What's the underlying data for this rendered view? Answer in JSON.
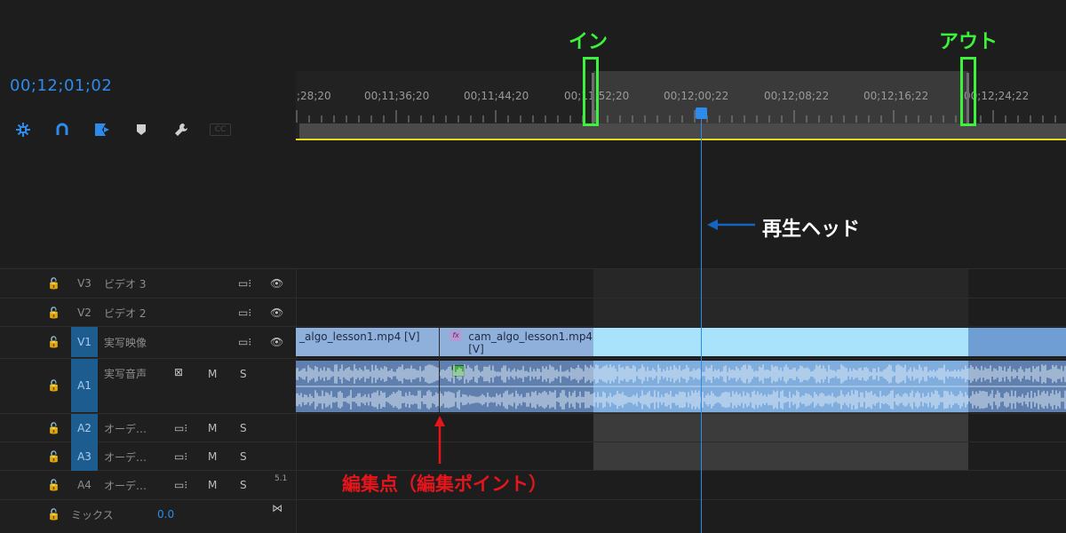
{
  "timecode": "00;12;01;02",
  "ruler": {
    "ticks": [
      ";28;20",
      "00;11;36;20",
      "00;11;44;20",
      "00;11;52;20",
      "00;12;00;22",
      "00;12;08;22",
      "00;12;16;22",
      "00;12;24;22"
    ]
  },
  "toolbar": {
    "icons": [
      "snap-icon",
      "magnet-link-icon",
      "add-marker-icon",
      "marker-icon",
      "wrench-icon",
      "captions-icon"
    ],
    "captions_label": "CC"
  },
  "tracks": {
    "v3": {
      "name": "V3",
      "label": "ビデオ 3"
    },
    "v2": {
      "name": "V2",
      "label": "ビデオ 2"
    },
    "v1": {
      "name": "V1",
      "label": "実写映像"
    },
    "a1": {
      "name": "A1",
      "label": "実写音声",
      "m": "M",
      "s": "S"
    },
    "a2": {
      "name": "A2",
      "label": "オーデ…",
      "m": "M",
      "s": "S"
    },
    "a3": {
      "name": "A3",
      "label": "オーデ…",
      "m": "M",
      "s": "S"
    },
    "a4": {
      "name": "A4",
      "label": "オーデ…",
      "m": "M",
      "s": "S",
      "channels": "5.1"
    },
    "mix": {
      "label": "ミックス",
      "value": "0.0"
    }
  },
  "clips": {
    "v1_left": "_algo_lesson1.mp4 [V]",
    "v1_right": "cam_algo_lesson1.mp4 [V]",
    "fx_badge": "fx"
  },
  "annotations": {
    "in": "イン",
    "out": "アウト",
    "playhead": "再生ヘッド",
    "edit_point": "編集点（編集ポイント）"
  },
  "colors": {
    "accent_blue": "#2d8ceb",
    "annot_green": "#3df23d",
    "annot_red": "#e4151b",
    "annot_blue": "#1565c0",
    "clip_light": "#9fd9f9",
    "clip_dark": "#8eb0da",
    "work_area": "#e6d81c"
  }
}
